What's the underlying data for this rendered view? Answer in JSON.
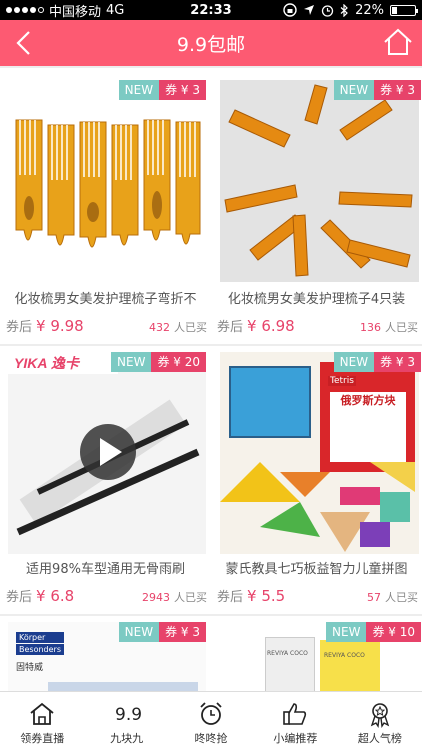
{
  "status": {
    "carrier": "中国移动",
    "network": "4G",
    "time": "22:33",
    "battery": "22%",
    "battery_level": 0.22
  },
  "nav": {
    "title": "9.9包邮"
  },
  "colors": {
    "brand": "#fd5a72",
    "coupon": "#e7436a",
    "new_tag": "#7ccac3"
  },
  "products": [
    {
      "new": "NEW",
      "coupon": "券 ¥ 3",
      "name": "化妆梳男女美发护理梳子弯折不",
      "price_label": "券后",
      "price": "¥ 9.98",
      "sold": "432",
      "sold_label": "人已买"
    },
    {
      "new": "NEW",
      "coupon": "券 ¥ 3",
      "name": "化妆梳男女美发护理梳子4只装",
      "price_label": "券后",
      "price": "¥ 6.98",
      "sold": "136",
      "sold_label": "人已买"
    },
    {
      "new": "NEW",
      "coupon": "券 ¥ 20",
      "name": "适用98%车型通用无骨雨刷",
      "price_label": "券后",
      "price": "¥ 6.8",
      "sold": "2943",
      "sold_label": "人已买",
      "brand_text": "YIKA 逸卡"
    },
    {
      "new": "NEW",
      "coupon": "券 ¥ 3",
      "name": "蒙氏教具七巧板益智力儿童拼图",
      "price_label": "券后",
      "price": "¥ 5.5",
      "sold": "57",
      "sold_label": "人已买",
      "box_text": "俄罗斯方块",
      "box_brand": "Tetris"
    },
    {
      "new": "NEW",
      "coupon": "券 ¥ 3",
      "brand_text1": "Körper",
      "brand_text2": "Besonders",
      "brand_text3": "固特威"
    },
    {
      "new": "NEW",
      "coupon": "券 ¥ 10",
      "brand_text1": "REVIYA COCO",
      "brand_text2": "REVIYA COCO"
    }
  ],
  "tabs": [
    {
      "label": "领券直播",
      "icon": "home-icon"
    },
    {
      "label": "九块九",
      "icon": "nine-nine-icon"
    },
    {
      "label": "咚咚抢",
      "icon": "alarm-clock-icon"
    },
    {
      "label": "小编推荐",
      "icon": "thumbs-up-icon"
    },
    {
      "label": "超人气榜",
      "icon": "medal-icon"
    }
  ]
}
